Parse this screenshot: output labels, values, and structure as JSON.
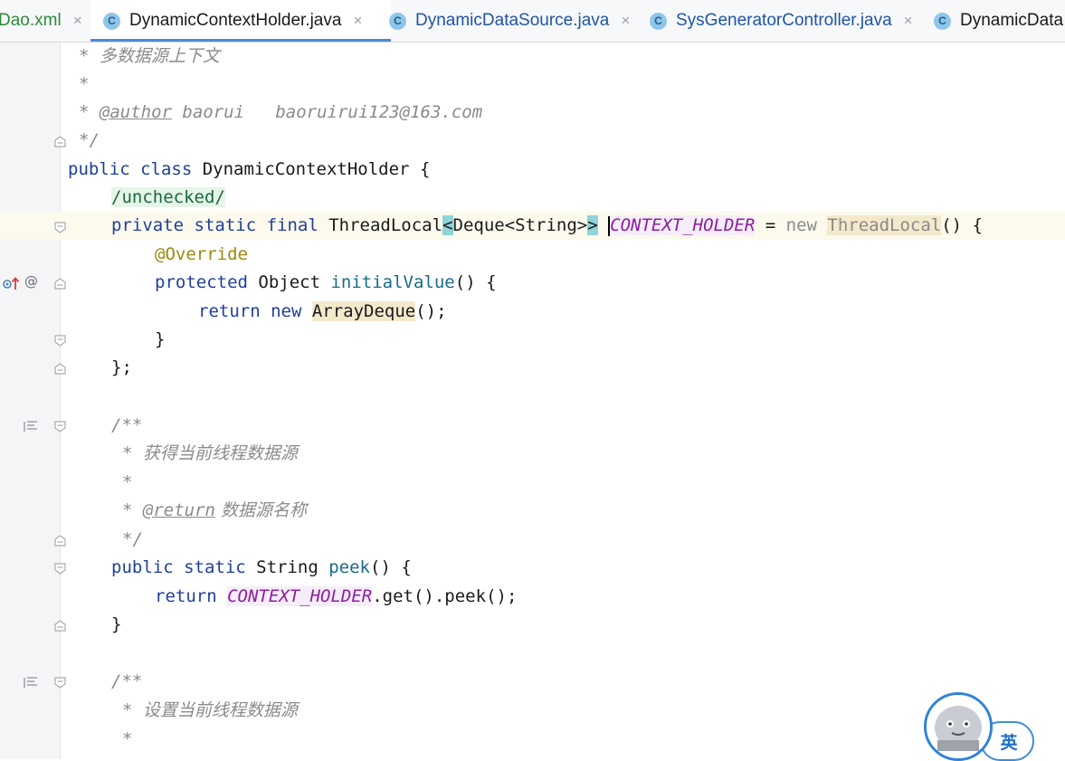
{
  "tabs": [
    {
      "label": "Dao.xml",
      "icon": "none",
      "active": false
    },
    {
      "label": "DynamicContextHolder.java",
      "icon": "C",
      "active": true
    },
    {
      "label": "DynamicDataSource.java",
      "icon": "C",
      "active": false
    },
    {
      "label": "SysGeneratorController.java",
      "icon": "C",
      "active": false
    },
    {
      "label": "DynamicData",
      "icon": "C",
      "active": false
    }
  ],
  "close_glyph": "×",
  "code": {
    "l1": [
      "* ",
      "多数据源上下文"
    ],
    "l2": "*",
    "l3": {
      "star": "* ",
      "tag": "@author",
      "rest": " baorui   baoruirui123@163.com"
    },
    "l4": "*/",
    "l5": {
      "kw": "public class ",
      "name": "DynamicContextHolder",
      "rest": " {"
    },
    "l6": "/unchecked/",
    "l7": {
      "kw": "private static final ",
      "type": "ThreadLocal",
      "lt": "<",
      "generic": "Deque<String>",
      "gt": ">",
      "field": "CONTEXT_HOLDER",
      "eq": " = ",
      "new": "new ",
      "cls": "ThreadLocal",
      "tail": "() {"
    },
    "l8": "@Override",
    "l9": {
      "kw": "protected ",
      "type": "Object ",
      "fn": "initialValue",
      "tail": "() {"
    },
    "l10": {
      "kw": "return new ",
      "cls": "ArrayDeque",
      "tail": "();"
    },
    "l11": "}",
    "l12": "};",
    "l14": "/**",
    "l15": [
      "* ",
      "获得当前线程数据源"
    ],
    "l16": "*",
    "l17": {
      "star": "* ",
      "tag": "@return",
      "rest": " 数据源名称"
    },
    "l18": "*/",
    "l19": {
      "kw": "public static ",
      "type": "String ",
      "fn": "peek",
      "tail": "() {"
    },
    "l20": {
      "kw": "return ",
      "field": "CONTEXT_HOLDER",
      "tail": ".get().peek();"
    },
    "l21": "}",
    "l23": "/**",
    "l24": [
      "* ",
      "设置当前线程数据源"
    ],
    "l25": "*"
  },
  "ime": {
    "label": "英"
  },
  "gutter_marker": "@"
}
